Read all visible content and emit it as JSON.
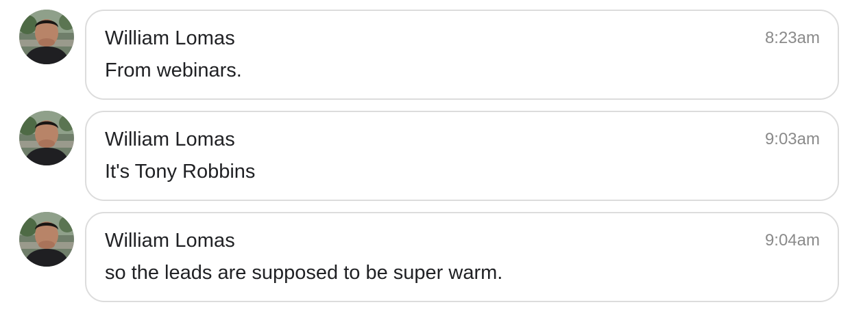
{
  "colors": {
    "bubble_border": "#dcdcdc",
    "sender_text": "#202124",
    "timestamp_text": "#8a8a8a",
    "background": "#ffffff"
  },
  "messages": [
    {
      "sender": "William Lomas",
      "time": "8:23am",
      "text": "From webinars.",
      "avatar_icon": "user-avatar-photo"
    },
    {
      "sender": "William Lomas",
      "time": "9:03am",
      "text": "It's Tony Robbins",
      "avatar_icon": "user-avatar-photo"
    },
    {
      "sender": "William Lomas",
      "time": "9:04am",
      "text": "so the leads are supposed to be super warm.",
      "avatar_icon": "user-avatar-photo"
    }
  ]
}
